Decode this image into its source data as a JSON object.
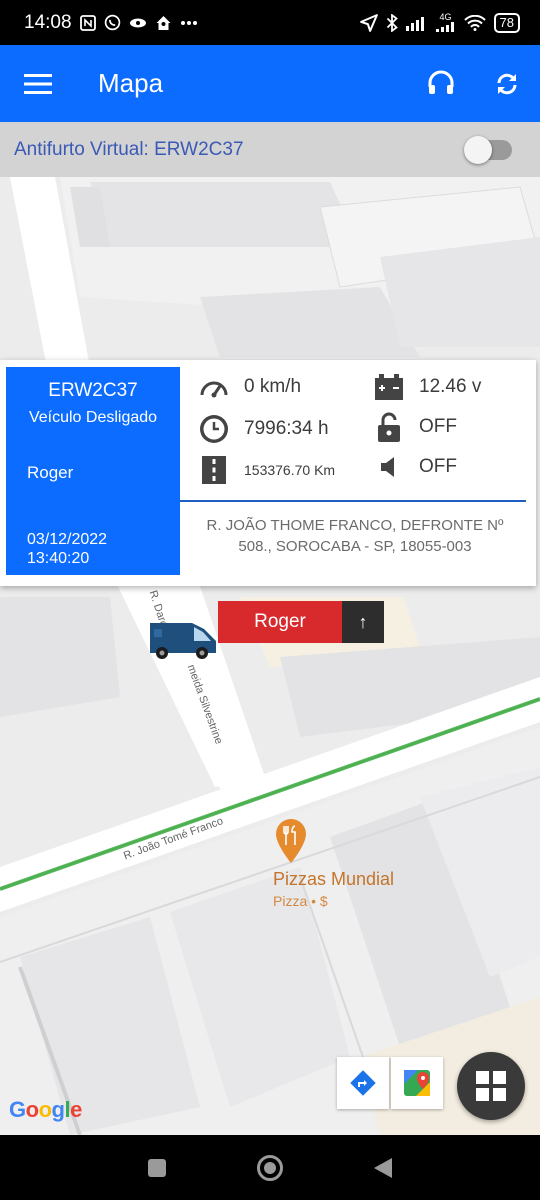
{
  "status_bar": {
    "time": "14:08",
    "battery": "78",
    "network": "4G"
  },
  "app_bar": {
    "title": "Mapa"
  },
  "antitheft": {
    "label": "Antifurto Virtual: ERW2C37",
    "enabled": false
  },
  "info_card": {
    "plate": "ERW2C37",
    "engine_state": "Veículo Desligado",
    "driver": "Roger",
    "date": "03/12/2022",
    "time": "13:40:20",
    "speed": "0 km/h",
    "hours": "7996:34 h",
    "odometer": "153376.70 Km",
    "battery_voltage": "12.46 v",
    "lock_status": "OFF",
    "sound_status": "OFF",
    "address": "R. JOÃO THOME FRANCO, DEFRONTE Nº 508., SOROCABA - SP, 18055-003"
  },
  "vehicle_marker": {
    "name": "Roger",
    "heading_arrow": "↑"
  },
  "map": {
    "street_1": "R. Darc",
    "street_2": "meida Silvestrine",
    "street_3": "R. João Tomé Franco",
    "poi_name": "Pizzas Mundial",
    "poi_category": "Pizza • $",
    "provider_logo": "Google"
  },
  "colors": {
    "primary": "#0b6cff",
    "vehicle_label": "#d82a2d",
    "poi": "#e68a2e",
    "route": "#4caf50"
  }
}
